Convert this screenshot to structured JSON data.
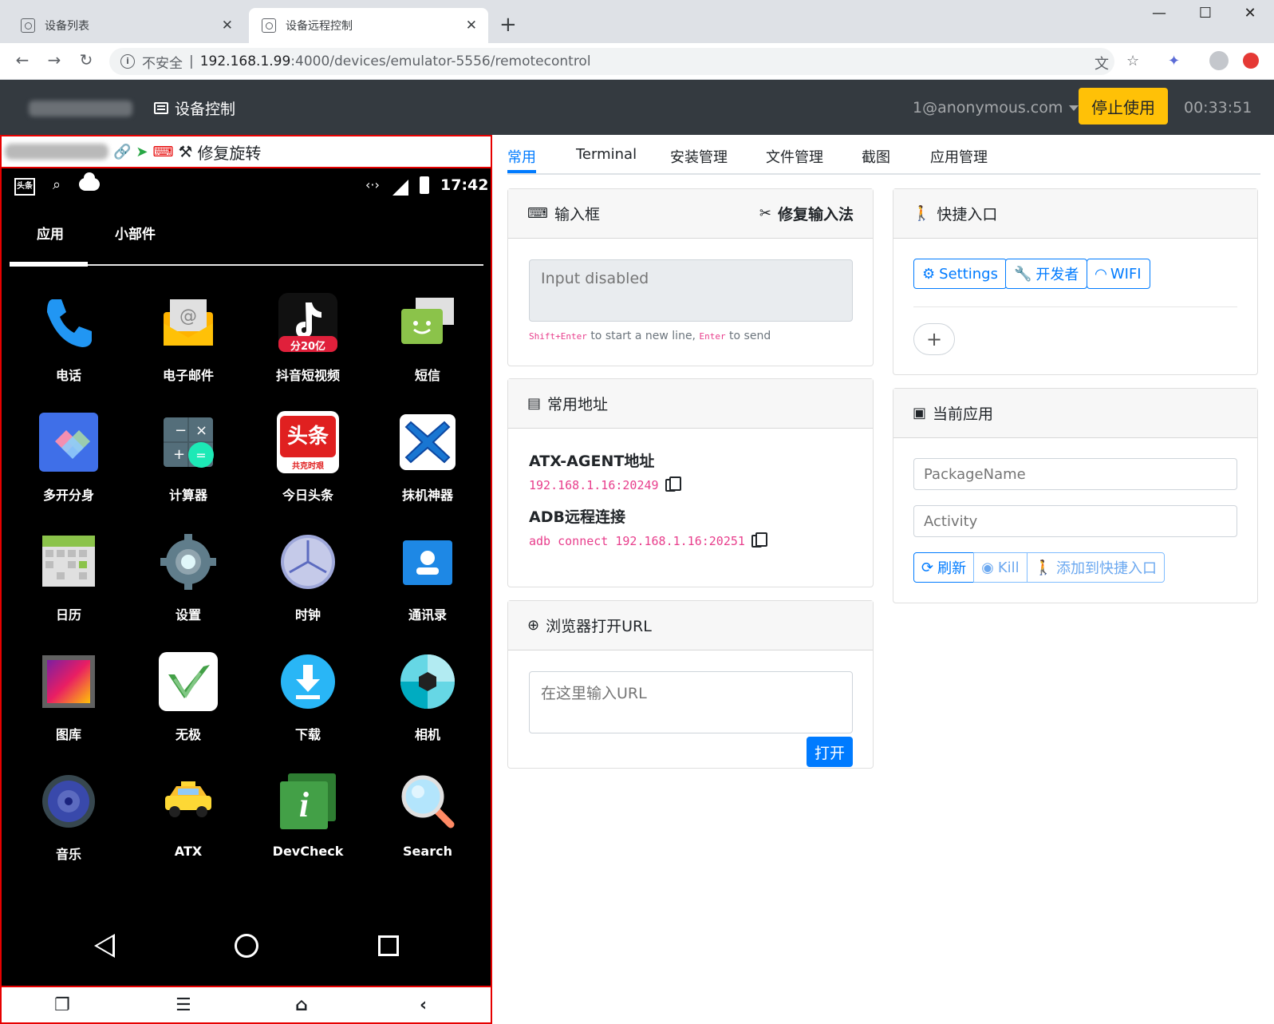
{
  "browser": {
    "tabs": [
      {
        "title": "设备列表"
      },
      {
        "title": "设备远程控制"
      }
    ],
    "new_tab": "+",
    "window_controls": {
      "minimize": "—",
      "maximize": "☐",
      "close": "✕"
    },
    "url": {
      "security": "不安全",
      "separator": "|",
      "host": "192.168.1.99",
      "path": ":4000/devices/emulator-5556/remotecontrol"
    }
  },
  "navbar": {
    "title": "设备控制",
    "user": "1@anonymous.com",
    "stop_button": "停止使用",
    "timer": "00:33:51"
  },
  "device": {
    "fix_rotation": "修复旋转",
    "status": {
      "time": "17:42",
      "toutiao": "头条"
    },
    "drawer_tabs": [
      "应用",
      "小部件"
    ],
    "apps": [
      {
        "label": "电话",
        "icon": "phone-icon"
      },
      {
        "label": "电子邮件",
        "icon": "email-icon"
      },
      {
        "label": "抖音短视频",
        "icon": "tiktok-icon"
      },
      {
        "label": "短信",
        "icon": "sms-icon"
      },
      {
        "label": "多开分身",
        "icon": "multi-open-icon"
      },
      {
        "label": "计算器",
        "icon": "calculator-icon"
      },
      {
        "label": "今日头条",
        "icon": "toutiao-icon"
      },
      {
        "label": "抹机神器",
        "icon": "eraser-icon"
      },
      {
        "label": "日历",
        "icon": "calendar-icon"
      },
      {
        "label": "设置",
        "icon": "settings-icon"
      },
      {
        "label": "时钟",
        "icon": "clock-icon"
      },
      {
        "label": "通讯录",
        "icon": "contacts-icon"
      },
      {
        "label": "图库",
        "icon": "gallery-icon"
      },
      {
        "label": "无极",
        "icon": "wuji-icon"
      },
      {
        "label": "下载",
        "icon": "download-icon"
      },
      {
        "label": "相机",
        "icon": "camera-icon"
      },
      {
        "label": "音乐",
        "icon": "music-icon"
      },
      {
        "label": "ATX",
        "icon": "atx-icon"
      },
      {
        "label": "DevCheck",
        "icon": "devcheck-icon"
      },
      {
        "label": "Search",
        "icon": "search-icon"
      }
    ],
    "app_icon_text": {
      "tiktok": "分20亿",
      "toutiao_top": "头条",
      "toutiao_bottom": "共克时艰",
      "devcheck": "i"
    }
  },
  "tabs": [
    "常用",
    "Terminal",
    "安装管理",
    "文件管理",
    "截图",
    "应用管理"
  ],
  "input_card": {
    "title": "输入框",
    "fix_ime": "修复输入法",
    "placeholder": "Input disabled",
    "hint_shift": "Shift+Enter",
    "hint_mid": "to start a new line,",
    "hint_enter": "Enter",
    "hint_end": "to send"
  },
  "address_card": {
    "title": "常用地址",
    "atx_label": "ATX-AGENT地址",
    "atx_value": "192.168.1.16:20249",
    "adb_label": "ADB远程连接",
    "adb_value": "adb connect 192.168.1.16:20251"
  },
  "url_card": {
    "title": "浏览器打开URL",
    "placeholder": "在这里输入URL",
    "open_button": "打开"
  },
  "shortcut_card": {
    "title": "快捷入口",
    "buttons": [
      "Settings",
      "开发者",
      "WIFI"
    ],
    "add": "+"
  },
  "current_app_card": {
    "title": "当前应用",
    "package_placeholder": "PackageName",
    "activity_placeholder": "Activity",
    "refresh": "刷新",
    "kill": "Kill",
    "add_shortcut": "添加到快捷入口"
  },
  "colors": {
    "primary": "#007bff",
    "warning": "#ffc107",
    "navbar": "#343a40",
    "device_border": "#e60000",
    "code": "#e83e8c"
  }
}
